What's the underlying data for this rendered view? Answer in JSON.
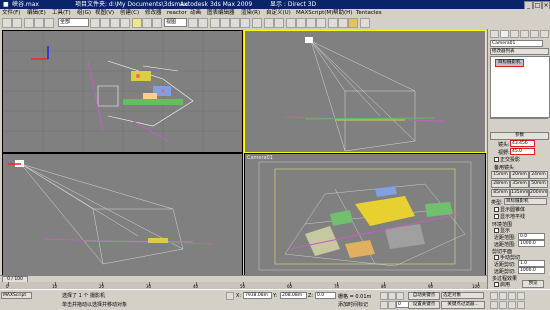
{
  "title": {
    "file": "峡谷.max",
    "project": "项目文件夹: d:\\My Documents\\3dsmax",
    "app": "Autodesk 3ds Max 2009",
    "display": "显示 : Direct 3D"
  },
  "menu": [
    "文件(F)",
    "编辑(E)",
    "工具(T)",
    "组(G)",
    "视图(V)",
    "创建(C)",
    "修改器",
    "reactor",
    "动画",
    "图表编辑器",
    "渲染(R)",
    "自定义(U)",
    "MAXScript(M)",
    "帮助(H)",
    "Tentacles"
  ],
  "toolbar": {
    "selection_filter": "全部",
    "view_dropdown": "视图"
  },
  "viewports": {
    "top_left": {
      "label": ""
    },
    "top_right": {
      "label": ""
    },
    "bottom_left": {
      "label": ""
    },
    "bottom_right": {
      "label": "Camera01"
    }
  },
  "panel": {
    "object_name": "Camera01",
    "modifier_list": "修改器列表",
    "stack_item": "目标摄影机",
    "rollout_title": "参数",
    "lens_label": "镜头:",
    "lens_value": "43.456",
    "fov_label": "视野:",
    "fov_value": "45.0",
    "ortho_label": "正交投影",
    "stock_lenses_title": "备用镜头",
    "lenses": [
      "15mm",
      "20mm",
      "24mm",
      "28mm",
      "35mm",
      "50mm",
      "85mm",
      "135mm",
      "200mm"
    ],
    "type_label": "类型:",
    "type_value": "目标摄影机",
    "show_cone": "显示圆锥体",
    "show_horizon": "显示地平线",
    "env_ranges": "环境范围",
    "show": "显示",
    "near_range_label": "近距范围:",
    "near_range_value": "0.0",
    "far_range_label": "远距范围:",
    "far_range_value": "1000.0",
    "clip_planes": "剪切平面",
    "manual_clip": "手动剪切",
    "near_clip_label": "近距剪切:",
    "near_clip_value": "1.0",
    "far_clip_label": "远距剪切:",
    "far_clip_value": "1000.0",
    "multipass": "多过程效果",
    "enable": "启用",
    "preview": "预览"
  },
  "timeline": {
    "position": "0 / 100",
    "ticks": [
      "0",
      "10",
      "20",
      "30",
      "40",
      "50",
      "60",
      "70",
      "80",
      "90",
      "100"
    ]
  },
  "status": {
    "maxscript": "MAXScript",
    "selected": "选择了 1 个 摄影机",
    "prompt": "单击并拖动以选择并移动对象",
    "x_label": "X:",
    "x_value": "7938.08m",
    "y_label": "Y:",
    "y_value": "208.08m",
    "z_label": "Z:",
    "z_value": "0.0",
    "grid": "栅格 = 0.01m",
    "add_time_tag": "添加时间标记",
    "auto_key": "自动关键点",
    "set_key": "设置关键点",
    "key_filters": "关键点过滤器...",
    "selected_dropdown": "选定对象",
    "frame": "0"
  }
}
